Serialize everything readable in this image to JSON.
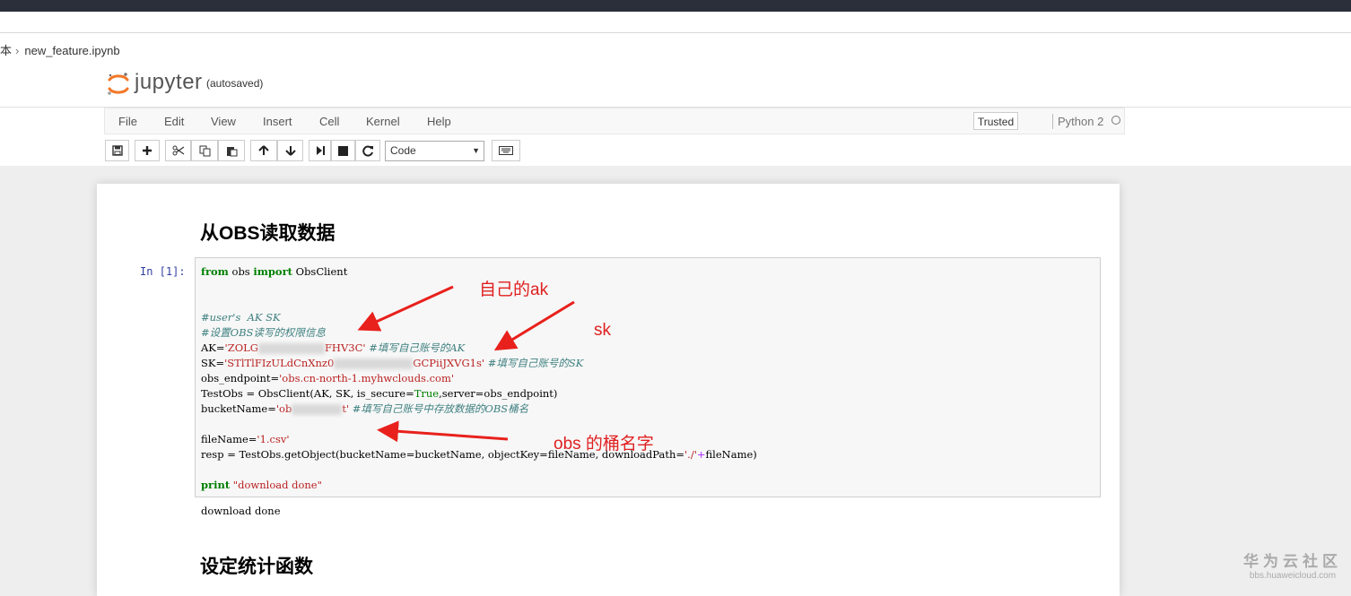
{
  "breadcrumb": {
    "parent": "本",
    "separator": "›",
    "filename": "new_feature.ipynb"
  },
  "header": {
    "logo_text": "jupyter",
    "save_status": "(autosaved)"
  },
  "menu": {
    "items": [
      "File",
      "Edit",
      "View",
      "Insert",
      "Cell",
      "Kernel",
      "Help"
    ],
    "trusted_label": "Trusted",
    "kernel_name": "Python 2"
  },
  "toolbar": {
    "cell_type": "Code",
    "buttons": [
      "save-icon",
      "plus-icon",
      "cut-icon",
      "copy-icon",
      "paste-icon",
      "arrow-up-icon",
      "arrow-down-icon",
      "step-forward-icon",
      "stop-icon",
      "refresh-icon",
      "keyboard-icon"
    ]
  },
  "notebook": {
    "heading1": "从OBS读取数据",
    "prompt": "In  [1]:",
    "code": {
      "l1_from": "from",
      "l1_mod": " obs ",
      "l1_import": "import",
      "l1_name": " ObsClient",
      "l4": "#user's  AK SK",
      "l5": "#设置OBS读写的权限信息",
      "l6_a": "AK=",
      "l6_b": "'ZOLG",
      "l6_c": "FHV3C'",
      "l6_cmt": " #填写自己账号的AK",
      "l7_a": "SK=",
      "l7_b": "'STlTlFIzULdCnXnz0",
      "l7_c": "GCPiiJXVG1s'",
      "l7_cmt": " #填写自己账号的SK",
      "l8_a": "obs_endpoint=",
      "l8_b": "'obs.cn-north-1.myhwclouds.com'",
      "l9_a": "TestObs = ObsClient(AK, SK, is_secure=",
      "l9_b": "True",
      "l9_c": ",server=obs_endpoint)",
      "l10_a": "bucketName=",
      "l10_b": "'ob",
      "l10_c": "t'",
      "l10_cmt": " #填写自己账号中存放数据的OBS桶名",
      "l12_a": "fileName=",
      "l12_b": "'1.csv'",
      "l13_a": "resp = TestObs.getObject(bucketName=bucketName, objectKey=fileName, downloadPath=",
      "l13_b": "'./'",
      "l13_op": "+",
      "l13_c": "fileName)",
      "l15_print": "print",
      "l15_str": " \"download done\""
    },
    "output": "download done",
    "heading2": "设定统计函数"
  },
  "annotations": {
    "ak": "自己的ak",
    "sk": "sk",
    "bucket": "obs 的桶名字"
  },
  "watermark": {
    "title": "华为云社区",
    "url": "bbs.huaweicloud.com"
  },
  "colors": {
    "annotation": "#e02020",
    "prompt": "#303f9f",
    "keyword": "#008000",
    "string": "#ba2121",
    "comment": "#408080"
  }
}
